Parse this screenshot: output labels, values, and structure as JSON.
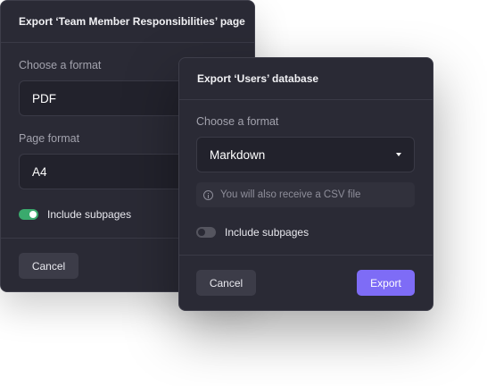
{
  "back_dialog": {
    "title": "Export ‘Team Member Responsibilities’ page",
    "format_label": "Choose a format",
    "format_value": "PDF",
    "page_format_label": "Page format",
    "page_format_value": "A4",
    "include_subpages_label": "Include subpages",
    "include_subpages_on": true,
    "cancel_label": "Cancel"
  },
  "front_dialog": {
    "title": "Export ‘Users’ database",
    "format_label": "Choose a format",
    "format_value": "Markdown",
    "info_text": "You will also receive a CSV file",
    "include_subpages_label": "Include subpages",
    "include_subpages_on": false,
    "cancel_label": "Cancel",
    "export_label": "Export"
  },
  "colors": {
    "panel": "#2a2a35",
    "accent": "#7e6cf6",
    "toggle_on": "#3aaa6d"
  }
}
